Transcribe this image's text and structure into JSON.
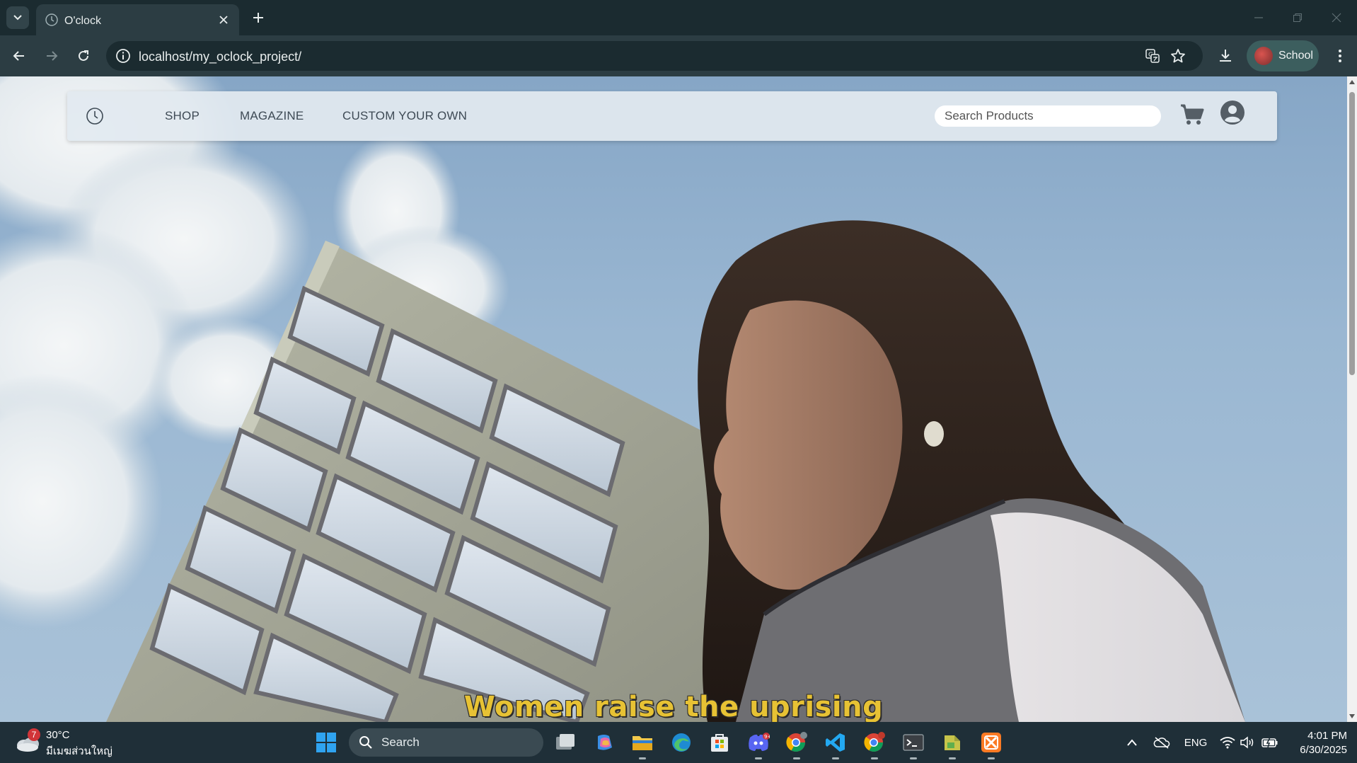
{
  "browser": {
    "tab_title": "O'clock",
    "url": "localhost/my_oclock_project/",
    "profile_name": "School"
  },
  "site": {
    "nav_links": [
      "SHOP",
      "MAGAZINE",
      "CUSTOM YOUR OWN"
    ],
    "search_placeholder": "Search Products",
    "hero_subtitle": "Women raise the uprising"
  },
  "taskbar": {
    "weather_temp": "30°C",
    "weather_condition": "มีเมฆส่วนใหญ่",
    "weather_badge": "7",
    "search_label": "Search",
    "language": "ENG",
    "time": "4:01 PM",
    "date": "6/30/2025"
  },
  "colors": {
    "chrome_dark": "#1b2b30",
    "chrome_toolbar": "#2c3d43",
    "subtitle_yellow": "#e7c234",
    "taskbar_bg": "#1f2f38"
  }
}
